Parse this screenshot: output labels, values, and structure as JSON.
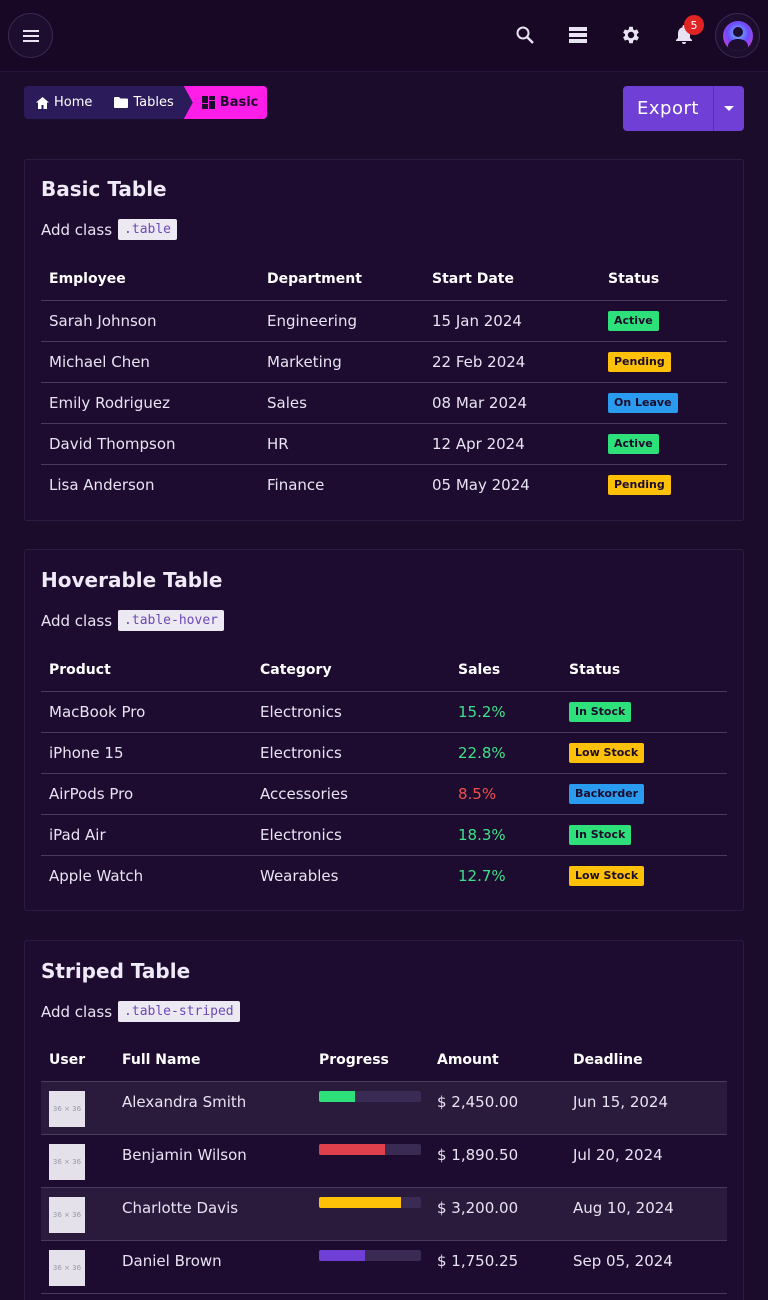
{
  "topbar": {
    "notification_count": "5"
  },
  "breadcrumb": {
    "items": [
      {
        "label": "Home",
        "icon": "home-icon"
      },
      {
        "label": "Tables",
        "icon": "folder-icon"
      },
      {
        "label": "Basic",
        "icon": "dashboard-icon"
      }
    ]
  },
  "export": {
    "label": "Export"
  },
  "basic_table": {
    "title": "Basic Table",
    "sub_prefix": "Add class",
    "code": ".table",
    "headers": [
      "Employee",
      "Department",
      "Start Date",
      "Status"
    ],
    "rows": [
      {
        "employee": "Sarah Johnson",
        "department": "Engineering",
        "start": "15 Jan 2024",
        "status": "Active",
        "status_color": "#2ee07a"
      },
      {
        "employee": "Michael Chen",
        "department": "Marketing",
        "start": "22 Feb 2024",
        "status": "Pending",
        "status_color": "#ffc107"
      },
      {
        "employee": "Emily Rodriguez",
        "department": "Sales",
        "start": "08 Mar 2024",
        "status": "On Leave",
        "status_color": "#2a9cf0"
      },
      {
        "employee": "David Thompson",
        "department": "HR",
        "start": "12 Apr 2024",
        "status": "Active",
        "status_color": "#2ee07a"
      },
      {
        "employee": "Lisa Anderson",
        "department": "Finance",
        "start": "05 May 2024",
        "status": "Pending",
        "status_color": "#ffc107"
      }
    ]
  },
  "hover_table": {
    "title": "Hoverable Table",
    "sub_prefix": "Add class",
    "code": ".table-hover",
    "headers": [
      "Product",
      "Category",
      "Sales",
      "Status"
    ],
    "rows": [
      {
        "product": "MacBook Pro",
        "category": "Electronics",
        "sales": "15.2%",
        "sales_color": "#3ee08a",
        "status": "In Stock",
        "status_color": "#2ee07a"
      },
      {
        "product": "iPhone 15",
        "category": "Electronics",
        "sales": "22.8%",
        "sales_color": "#3ee08a",
        "status": "Low Stock",
        "status_color": "#ffc107"
      },
      {
        "product": "AirPods Pro",
        "category": "Accessories",
        "sales": "8.5%",
        "sales_color": "#f0504c",
        "status": "Backorder",
        "status_color": "#2a9cf0"
      },
      {
        "product": "iPad Air",
        "category": "Electronics",
        "sales": "18.3%",
        "sales_color": "#3ee08a",
        "status": "In Stock",
        "status_color": "#2ee07a"
      },
      {
        "product": "Apple Watch",
        "category": "Wearables",
        "sales": "12.7%",
        "sales_color": "#3ee08a",
        "status": "Low Stock",
        "status_color": "#ffc107"
      }
    ]
  },
  "striped_table": {
    "title": "Striped Table",
    "sub_prefix": "Add class",
    "code": ".table-striped",
    "headers": [
      "User",
      "Full Name",
      "Progress",
      "Amount",
      "Deadline"
    ],
    "rows": [
      {
        "thumb": "36 × 36",
        "name": "Alexandra Smith",
        "progress": 0.35,
        "progress_color": "#2ee07a",
        "amount": "$ 2,450.00",
        "deadline": "Jun 15, 2024"
      },
      {
        "thumb": "36 × 36",
        "name": "Benjamin Wilson",
        "progress": 0.65,
        "progress_color": "#e0404c",
        "amount": "$ 1,890.50",
        "deadline": "Jul 20, 2024"
      },
      {
        "thumb": "36 × 36",
        "name": "Charlotte Davis",
        "progress": 0.8,
        "progress_color": "#ffc107",
        "amount": "$ 3,200.00",
        "deadline": "Aug 10, 2024"
      },
      {
        "thumb": "36 × 36",
        "name": "Daniel Brown",
        "progress": 0.45,
        "progress_color": "#6f3fd6",
        "amount": "$ 1,750.25",
        "deadline": "Sep 05, 2024"
      }
    ]
  }
}
